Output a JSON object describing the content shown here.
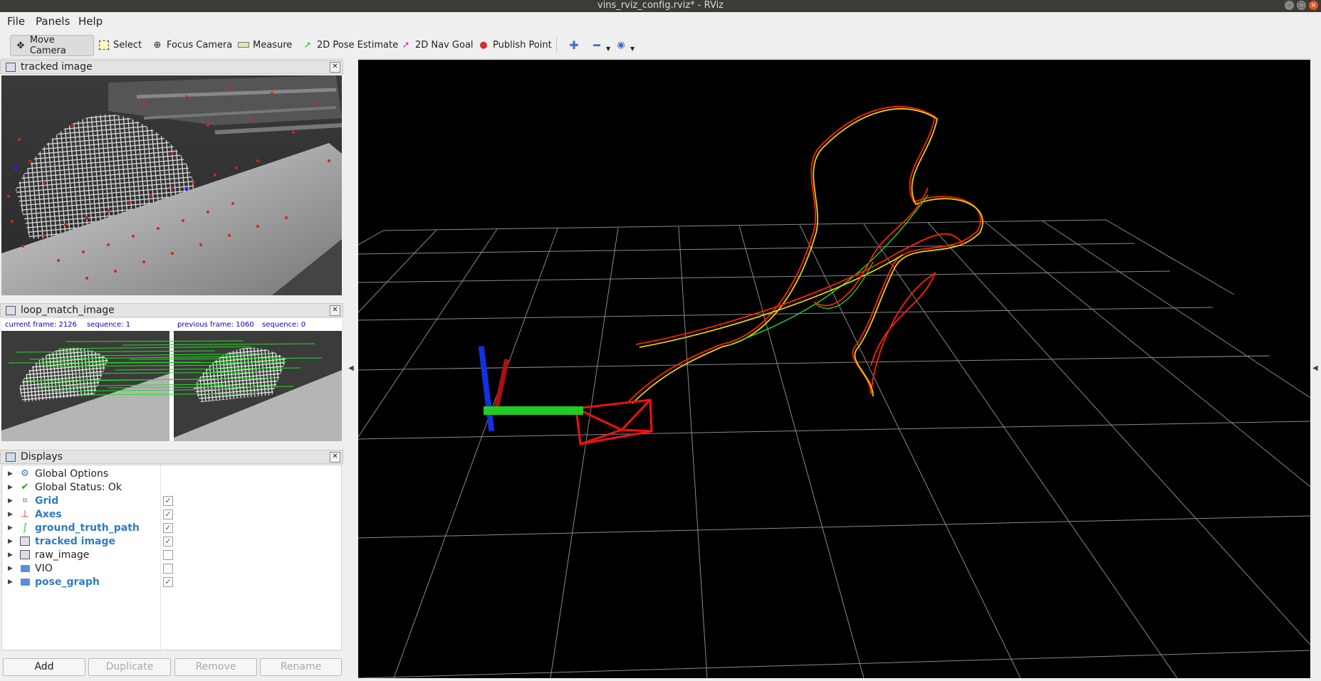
{
  "window": {
    "title": "vins_rviz_config.rviz* - RViz"
  },
  "menu": {
    "file": "File",
    "panels": "Panels",
    "help": "Help"
  },
  "toolbar": {
    "move_camera": "Move Camera",
    "select": "Select",
    "focus_camera": "Focus Camera",
    "measure": "Measure",
    "pose_estimate": "2D Pose Estimate",
    "nav_goal": "2D Nav Goal",
    "publish_point": "Publish Point"
  },
  "panels": {
    "tracked": {
      "title": "tracked image"
    },
    "loop": {
      "title": "loop_match_image",
      "current_frame": "current frame: 2126",
      "sequence_1": "sequence: 1",
      "previous_frame": "previous frame: 1060",
      "sequence_0": "sequence: 0"
    }
  },
  "displays": {
    "title": "Displays",
    "items": [
      {
        "label": "Global Options",
        "icon": "gear-icon",
        "enabled": null
      },
      {
        "label": "Global Status: Ok",
        "icon": "check-icon",
        "enabled": null
      },
      {
        "label": "Grid",
        "icon": "grid-icon",
        "enabled": true
      },
      {
        "label": "Axes",
        "icon": "axes-icon",
        "enabled": true
      },
      {
        "label": "ground_truth_path",
        "icon": "path-icon",
        "enabled": true
      },
      {
        "label": "tracked image",
        "icon": "image-icon",
        "enabled": true
      },
      {
        "label": "raw_image",
        "icon": "image-icon",
        "enabled": false
      },
      {
        "label": "VIO",
        "icon": "folder-icon",
        "enabled": false
      },
      {
        "label": "pose_graph",
        "icon": "folder-icon",
        "enabled": true
      }
    ],
    "buttons": {
      "add": "Add",
      "duplicate": "Duplicate",
      "remove": "Remove",
      "rename": "Rename"
    }
  },
  "colors": {
    "path_red": "#ff2200",
    "path_yellow": "#e6d000",
    "path_green": "#22dd22",
    "axis_x": "#ee1111",
    "axis_y": "#22cc22",
    "axis_z": "#1133dd",
    "grid": "#8a8a8a"
  }
}
